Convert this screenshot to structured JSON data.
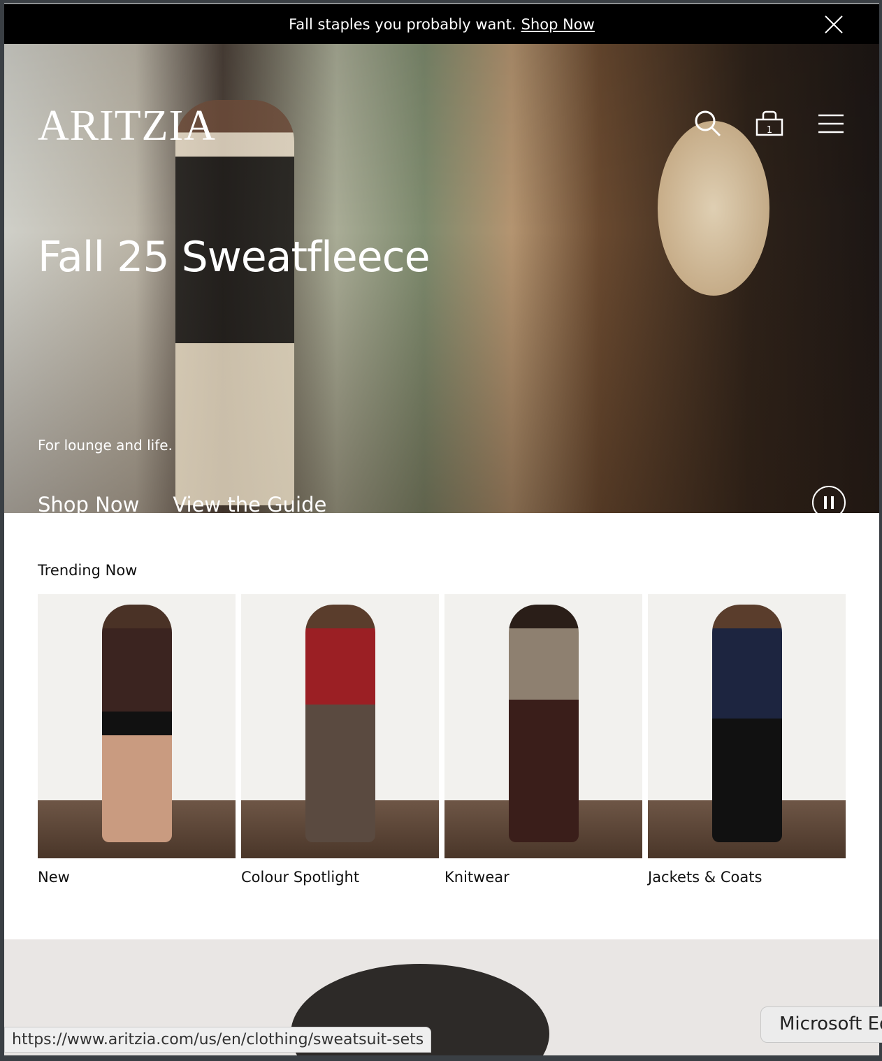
{
  "promo": {
    "text": "Fall staples you probably want.",
    "link": "Shop Now"
  },
  "header": {
    "logo": "ARITZIA",
    "cart_count": "1"
  },
  "hero": {
    "title": "Fall 25 Sweatfleece",
    "subtitle": "For lounge and life.",
    "cta_primary": "Shop Now",
    "cta_secondary": "View the Guide"
  },
  "trending": {
    "title": "Trending Now",
    "items": [
      {
        "label": "New",
        "color": "#3b2420"
      },
      {
        "label": "Colour Spotlight",
        "color": "#9b1f24"
      },
      {
        "label": "Knitwear",
        "color": "#8e8070"
      },
      {
        "label": "Jackets & Coats",
        "color": "#1d2540"
      }
    ]
  },
  "status_url": "https://www.aritzia.com/us/en/clothing/sweatsuit-sets",
  "tooltip": "Microsoft Edge"
}
